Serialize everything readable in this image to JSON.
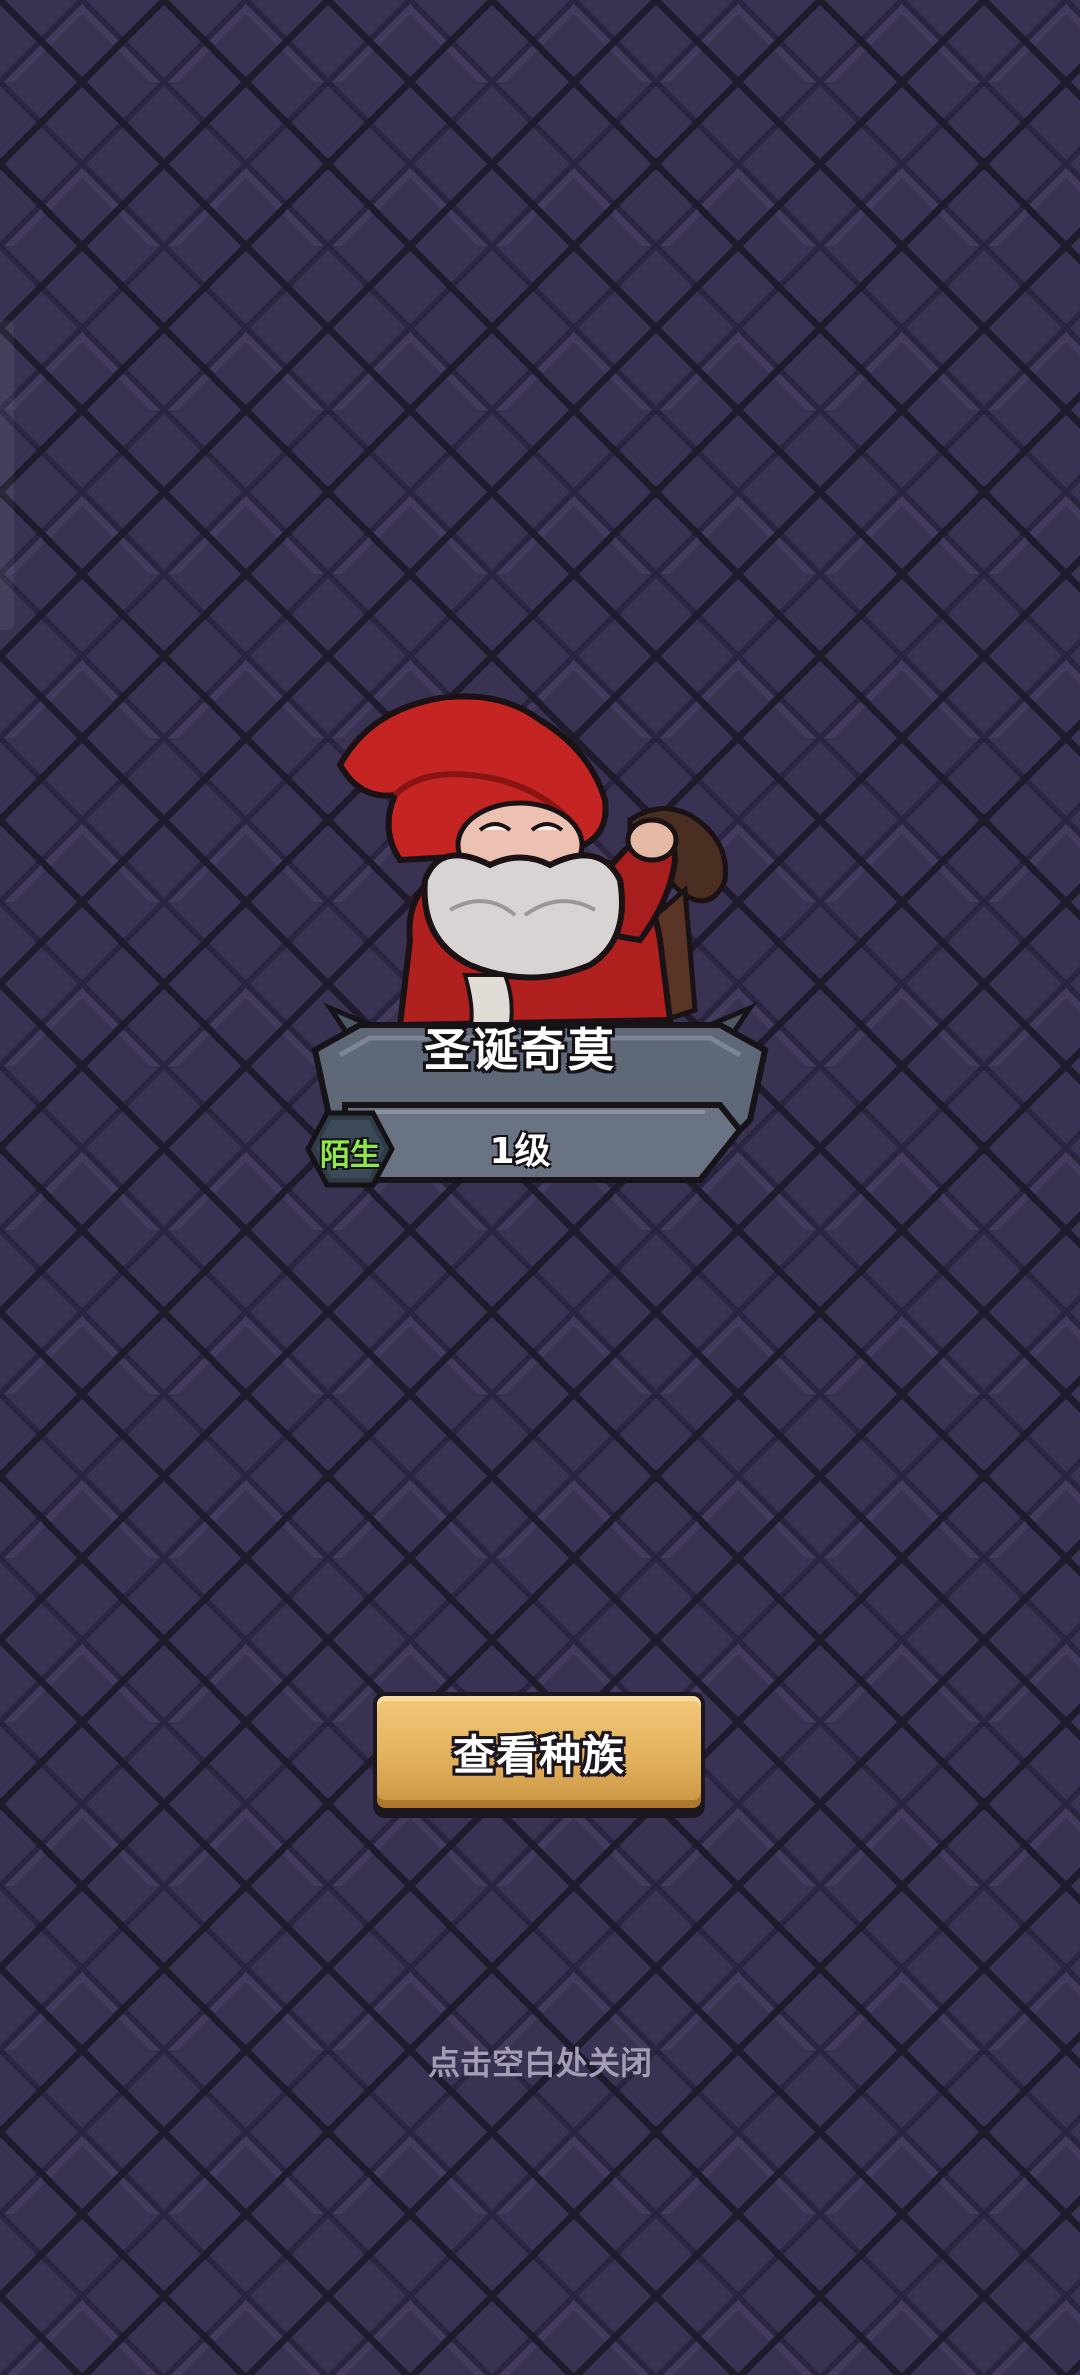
{
  "hero": {
    "name": "圣诞奇莫",
    "level": "1级",
    "status_badge": "陌生"
  },
  "actions": {
    "view_race_label": "查看种族"
  },
  "hint": {
    "close_text": "点击空白处关闭"
  },
  "colors": {
    "background": "#322b47",
    "tile_edge": "#1f1a2c",
    "button": "#e4b25e",
    "plaque": "#5b6472",
    "badge_text": "#8ee84a",
    "hint_text": "#a49db4"
  }
}
